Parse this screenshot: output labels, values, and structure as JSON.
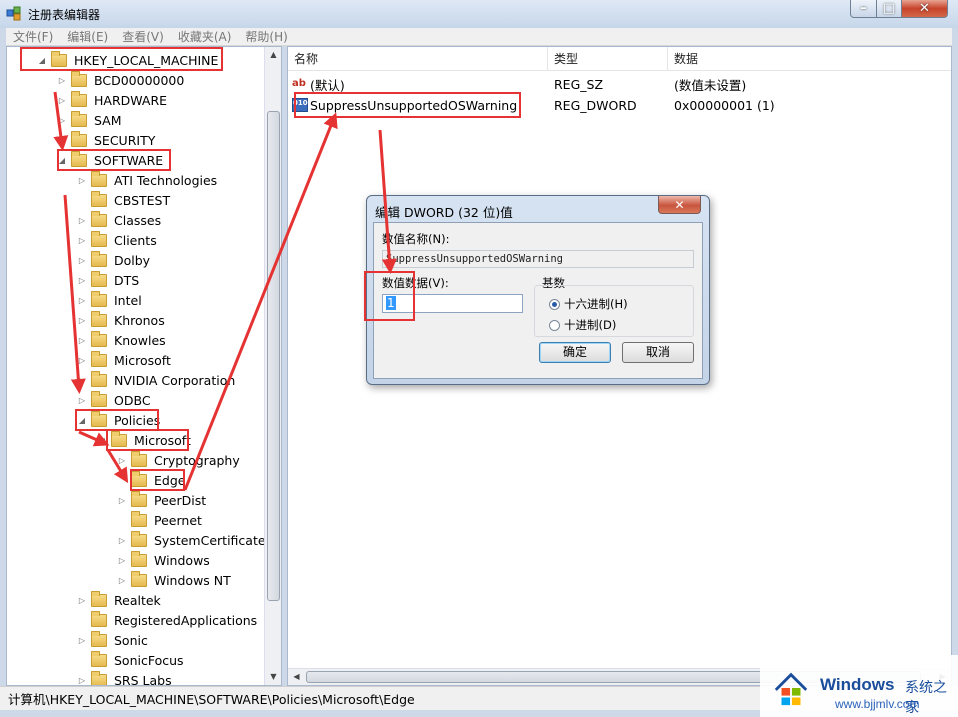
{
  "window": {
    "title": "注册表编辑器"
  },
  "menu": [
    "文件(F)",
    "编辑(E)",
    "查看(V)",
    "收藏夹(A)",
    "帮助(H)"
  ],
  "tree": [
    {
      "label": "HKEY_LOCAL_MACHINE",
      "expander": "◢",
      "indent": 0
    },
    {
      "label": "BCD00000000",
      "expander": "▷",
      "indent": 1
    },
    {
      "label": "HARDWARE",
      "expander": "▷",
      "indent": 1
    },
    {
      "label": "SAM",
      "expander": "▷",
      "indent": 1
    },
    {
      "label": "SECURITY",
      "expander": "",
      "indent": 1
    },
    {
      "label": "SOFTWARE",
      "expander": "◢",
      "indent": 1
    },
    {
      "label": "ATI Technologies",
      "expander": "▷",
      "indent": 2
    },
    {
      "label": "CBSTEST",
      "expander": "",
      "indent": 2
    },
    {
      "label": "Classes",
      "expander": "▷",
      "indent": 2
    },
    {
      "label": "Clients",
      "expander": "▷",
      "indent": 2
    },
    {
      "label": "Dolby",
      "expander": "▷",
      "indent": 2
    },
    {
      "label": "DTS",
      "expander": "▷",
      "indent": 2
    },
    {
      "label": "Intel",
      "expander": "▷",
      "indent": 2
    },
    {
      "label": "Khronos",
      "expander": "▷",
      "indent": 2
    },
    {
      "label": "Knowles",
      "expander": "▷",
      "indent": 2
    },
    {
      "label": "Microsoft",
      "expander": "▷",
      "indent": 2
    },
    {
      "label": "NVIDIA Corporation",
      "expander": "▷",
      "indent": 2
    },
    {
      "label": "ODBC",
      "expander": "▷",
      "indent": 2
    },
    {
      "label": "Policies",
      "expander": "◢",
      "indent": 2
    },
    {
      "label": "Microsoft",
      "expander": "◢",
      "indent": 3
    },
    {
      "label": "Cryptography",
      "expander": "▷",
      "indent": 4
    },
    {
      "label": "Edge",
      "expander": "",
      "indent": 4
    },
    {
      "label": "PeerDist",
      "expander": "▷",
      "indent": 4
    },
    {
      "label": "Peernet",
      "expander": "",
      "indent": 4
    },
    {
      "label": "SystemCertificates",
      "expander": "▷",
      "indent": 4
    },
    {
      "label": "Windows",
      "expander": "▷",
      "indent": 4
    },
    {
      "label": "Windows NT",
      "expander": "▷",
      "indent": 4
    },
    {
      "label": "Realtek",
      "expander": "▷",
      "indent": 2
    },
    {
      "label": "RegisteredApplications",
      "expander": "",
      "indent": 2
    },
    {
      "label": "Sonic",
      "expander": "▷",
      "indent": 2
    },
    {
      "label": "SonicFocus",
      "expander": "",
      "indent": 2
    },
    {
      "label": "SRS Labs",
      "expander": "▷",
      "indent": 2
    }
  ],
  "list": {
    "columns": [
      "名称",
      "类型",
      "数据"
    ],
    "rows": [
      {
        "icon": "ab",
        "name": "(默认)",
        "type": "REG_SZ",
        "data": "(数值未设置)"
      },
      {
        "icon": "010",
        "name": "SuppressUnsupportedOSWarning",
        "type": "REG_DWORD",
        "data": "0x00000001 (1)"
      }
    ]
  },
  "status": {
    "path": "计算机\\HKEY_LOCAL_MACHINE\\SOFTWARE\\Policies\\Microsoft\\Edge"
  },
  "dialog": {
    "title": "编辑 DWORD (32 位)值",
    "name_label": "数值名称(N):",
    "name_value": "SuppressUnsupportedOSWarning",
    "data_label": "数值数据(V):",
    "data_value": "1",
    "base_label": "基数",
    "radio_hex": "十六进制(H)",
    "radio_dec": "十进制(D)",
    "ok": "确定",
    "cancel": "取消"
  },
  "watermark": {
    "brand": "Windows",
    "brand_cn": "系统之家",
    "url": "www.bjjmlv.com"
  },
  "colors": {
    "annotation": "#e53232",
    "selection": "#3399ff"
  },
  "icons": {
    "folder": "folder-icon",
    "app": "regedit-icon",
    "close": "close-icon"
  }
}
